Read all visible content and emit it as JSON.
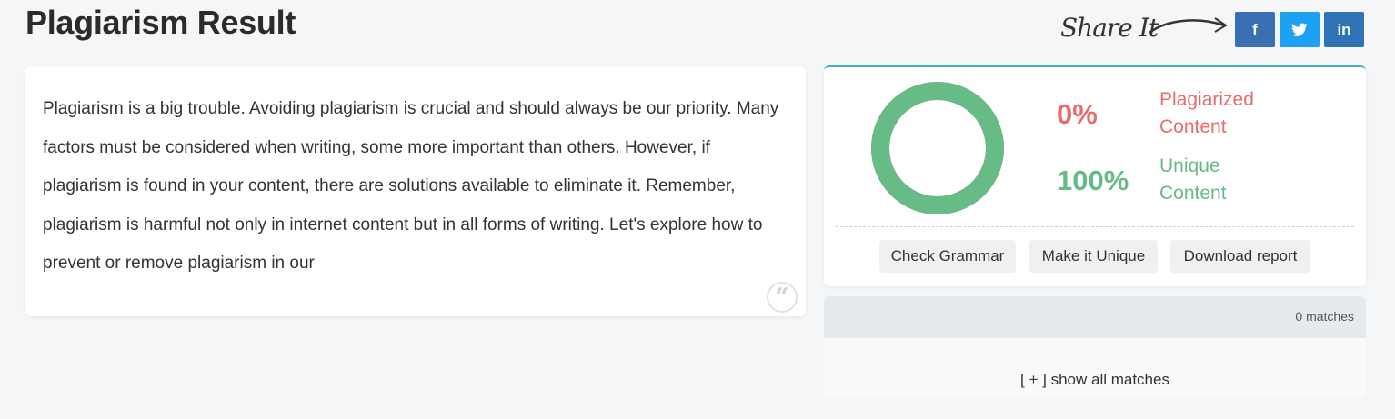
{
  "page": {
    "title": "Plagiarism Result"
  },
  "share": {
    "label": "Share It",
    "buttons": [
      {
        "network": "facebook",
        "glyph": "f",
        "color": "#3b6fb3"
      },
      {
        "network": "twitter",
        "glyph": "t",
        "color": "#1da1f2"
      },
      {
        "network": "linkedin",
        "glyph": "in",
        "color": "#2f73b6"
      }
    ]
  },
  "text_card": {
    "content": "Plagiarism is a big trouble. Avoiding plagiarism is crucial and should always be our priority. Many factors must be considered when writing, some more important than others. However, if plagiarism is found in your content, there are solutions available to eliminate it. Remember, plagiarism is harmful not only in internet content but in all forms of writing. Let's explore how to prevent or remove plagiarism in our",
    "icon": "quote-icon"
  },
  "result": {
    "plagiarized_percent": "0%",
    "plagiarized_label": "Plagiarized Content",
    "unique_percent": "100%",
    "unique_label": "Unique Content",
    "unique_fraction": 1.0,
    "colors": {
      "plagiarized": "#ea6b6b",
      "unique": "#67bb87",
      "accent": "#3fb0b8"
    },
    "actions": {
      "grammar": "Check Grammar",
      "unique": "Make it Unique",
      "download": "Download report"
    }
  },
  "matches": {
    "count_text": "0 matches",
    "show_all": "[ + ] show all matches"
  }
}
